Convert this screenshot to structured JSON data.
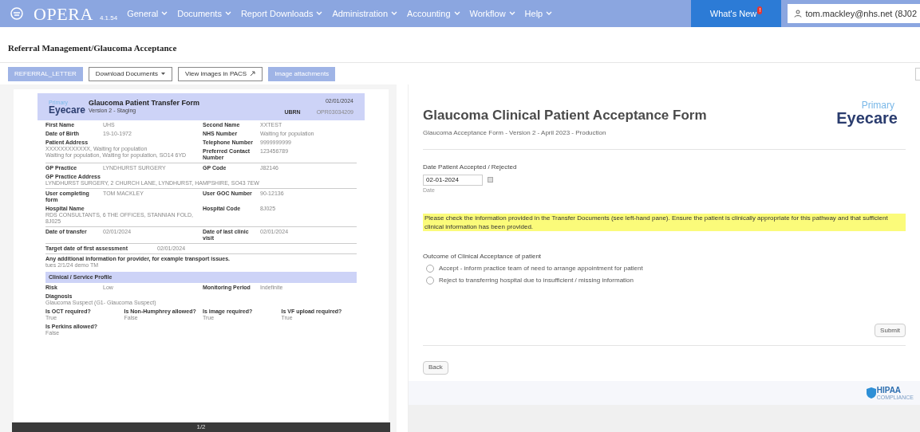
{
  "nav": {
    "brand": "OPERA",
    "version": "4.1.54",
    "menu": [
      "General",
      "Documents",
      "Report Downloads",
      "Administration",
      "Accounting",
      "Workflow",
      "Help"
    ],
    "whats_new": "What's New",
    "whats_new_badge": "!",
    "user": "tom.mackley@nhs.net (8J02"
  },
  "page_title": "Referral Management/Glaucoma Acceptance",
  "toolbar": [
    {
      "label": "REFERRAL_LETTER",
      "kind": "filled"
    },
    {
      "label": "Download Documents",
      "kind": "dropdown"
    },
    {
      "label": "View images in PACS",
      "kind": "link"
    },
    {
      "label": "Image attachments",
      "kind": "filled"
    }
  ],
  "document": {
    "logo_top": "Primary",
    "logo_main": "Eyecare",
    "title": "Glaucoma Patient Transfer Form",
    "version": "Version 2 - Staging",
    "date": "02/01/2024",
    "ubrn_label": "UBRN",
    "ubrn": "OPR03034209",
    "sections": [
      {
        "fields": [
          {
            "kind": "inline",
            "label": "First Name",
            "value": "UHS"
          },
          {
            "kind": "inline",
            "label": "Second Name",
            "value": "XXTEST"
          },
          {
            "kind": "inline",
            "label": "Date of Birth",
            "value": "19-10-1972"
          },
          {
            "kind": "inline",
            "label": "NHS Number",
            "value": "Waiting for population"
          },
          {
            "kind": "stacked",
            "label": "Patient Address",
            "value": "XXXXXXXXXXXX, Waiting for population\nWaiting for population, Waiting for population, SO14 6YD"
          },
          {
            "kind": "inline",
            "label": "Telephone Number",
            "value": "9999999999"
          },
          {
            "kind": "inline",
            "label": "Preferred Contact Number",
            "value": "123456789"
          }
        ]
      },
      {
        "fields": [
          {
            "kind": "inline",
            "label": "GP Practice",
            "value": "LYNDHURST SURGERY"
          },
          {
            "kind": "inline",
            "label": "GP Code",
            "value": "J82146"
          },
          {
            "kind": "wide",
            "label": "GP Practice Address",
            "value": "LYNDHURST SURGERY, 2 CHURCH LANE, LYNDHURST, HAMPSHIRE, SO43 7EW"
          }
        ]
      },
      {
        "fields": [
          {
            "kind": "inline",
            "label": "User completing form",
            "value": "TOM MACKLEY"
          },
          {
            "kind": "inline",
            "label": "User GOC Number",
            "value": "90-12136"
          },
          {
            "kind": "stacked",
            "label": "Hospital Name",
            "value": "RDS CONSULTANTS, 6 THE OFFICES, STANNIAN FOLD, 8J025"
          },
          {
            "kind": "inline",
            "label": "Hospital Code",
            "value": "8J025"
          }
        ]
      },
      {
        "fields": [
          {
            "kind": "inline",
            "label": "Date of transfer",
            "value": "02/01/2024"
          },
          {
            "kind": "inline",
            "label": "Date of last clinic visit",
            "value": "02/01/2024"
          }
        ]
      },
      {
        "fields": [
          {
            "kind": "wide-inline",
            "label": "Target date of first assessment",
            "value": "02/01/2024"
          }
        ]
      },
      {
        "fields": [
          {
            "kind": "wide",
            "label": "Any additional information for provider, for example transport issues.",
            "value": "tues 2/1/24 demo TM"
          }
        ]
      },
      {
        "heading": "Clinical / Service Profile",
        "fields": [
          {
            "kind": "inline",
            "label": "Risk",
            "value": "Low"
          },
          {
            "kind": "inline",
            "label": "Monitoring Period",
            "value": "Indefinite"
          },
          {
            "kind": "wide",
            "label": "Diagnosis",
            "value": "Glaucoma Suspect (G1- Glaucoma Suspect)"
          },
          {
            "kind": "quarter",
            "label": "Is OCT required?",
            "value": "True"
          },
          {
            "kind": "quarter",
            "label": "Is Non-Humphrey allowed?",
            "value": "False"
          },
          {
            "kind": "quarter",
            "label": "Is image required?",
            "value": "True"
          },
          {
            "kind": "quarter",
            "label": "Is VF upload required?",
            "value": "True"
          },
          {
            "kind": "wide",
            "label": "Is Perkins allowed?",
            "value": "False"
          }
        ]
      }
    ],
    "page_indicator": "1/2"
  },
  "form": {
    "title": "Glaucoma Clinical Patient Acceptance Form",
    "subtitle": "Glaucoma Acceptance Form - Version 2 - April 2023 - Production",
    "logo_top": "Primary",
    "logo_main": "Eyecare",
    "date_label": "Date Patient Accepted / Rejected",
    "date_value": "02-01-2024",
    "date_hint": "Date",
    "notice": "Please check the information provided in the Transfer Documents (see left-hand pane). Ensure the patient is clinically appropriate for this pathway and that sufficient clinical information has been provided.",
    "outcome": {
      "label": "Outcome of Clinical Acceptance of patient",
      "options": [
        {
          "label": "Accept - inform practice team of need to arrange appointment for patient",
          "selected": false
        },
        {
          "label": "Reject to transferring hospital due to insufficient / missing information",
          "selected": false
        }
      ]
    },
    "submit": "Submit",
    "back": "Back"
  },
  "footer": {
    "badge": "HIPAA",
    "badge_sub": "COMPLIANCE"
  }
}
